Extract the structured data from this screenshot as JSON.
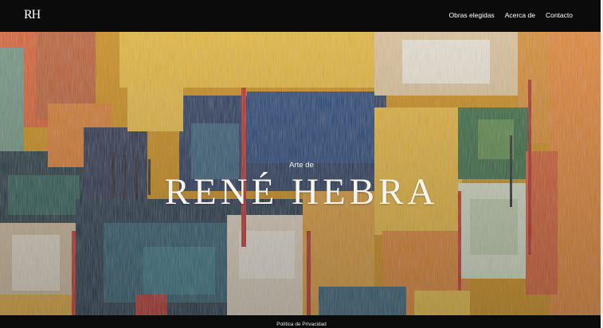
{
  "header": {
    "logo": "RH",
    "nav": [
      {
        "label": "Obras elegidas"
      },
      {
        "label": "Acerca de"
      },
      {
        "label": "Contacto"
      }
    ]
  },
  "hero": {
    "subtitle": "Arte de",
    "title": "RENÉ HEBRA"
  },
  "footer": {
    "privacy_link": "Política de Privacidad"
  },
  "colors": {
    "bars": "#0b0b0b",
    "hero_text": "#f7f4ee"
  }
}
